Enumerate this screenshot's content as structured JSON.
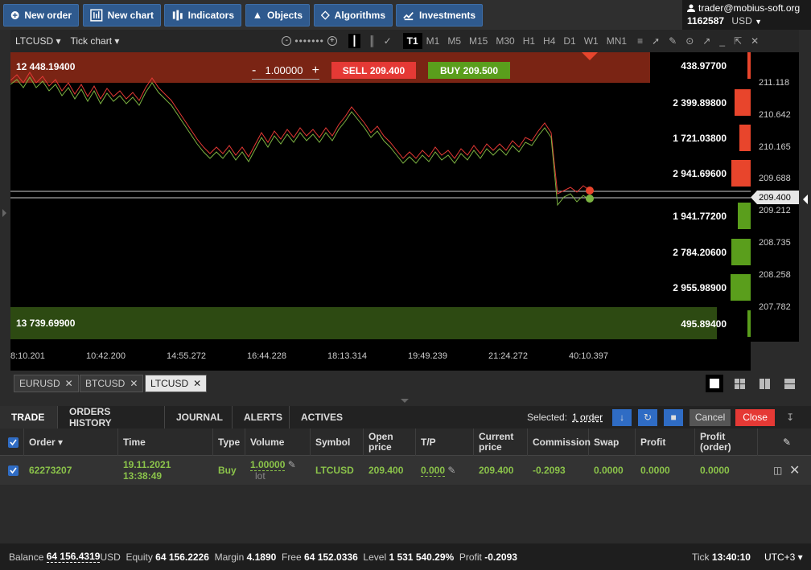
{
  "toolbar": {
    "new_order": "New order",
    "new_chart": "New chart",
    "indicators": "Indicators",
    "objects": "Objects",
    "algorithms": "Algorithms",
    "investments": "Investments"
  },
  "account": {
    "email": "trader@mobius-soft.org",
    "number": "1162587",
    "currency": "USD"
  },
  "chart_toolbar": {
    "symbol": "LTCUSD",
    "chart_type": "Tick chart",
    "timeframes": [
      "T1",
      "M1",
      "M5",
      "M15",
      "M30",
      "H1",
      "H4",
      "D1",
      "W1",
      "MN1"
    ],
    "active_timeframe": "T1"
  },
  "chart": {
    "upper_band_value": "12 448.19400",
    "lower_band_value": "13 739.69900",
    "quantity": "1.00000",
    "sell_label": "SELL",
    "sell_price": "209.400",
    "buy_label": "BUY",
    "buy_price": "209.500",
    "levels": [
      {
        "value": "438.97700",
        "side": "sell"
      },
      {
        "value": "2 399.89800",
        "side": "sell"
      },
      {
        "value": "1 721.03800",
        "side": "sell"
      },
      {
        "value": "2 941.69600",
        "side": "sell"
      },
      {
        "value": "1 941.77200",
        "side": "buy"
      },
      {
        "value": "2 784.20600",
        "side": "buy"
      },
      {
        "value": "2 955.98900",
        "side": "buy"
      },
      {
        "value": "495.89400",
        "side": "buy"
      }
    ],
    "price_ticks": [
      "211.118",
      "210.642",
      "210.165",
      "209.688",
      "209.212",
      "208.735",
      "208.258",
      "207.782"
    ],
    "current_price": "209.400",
    "time_ticks": [
      "8:10.201",
      "10:42.200",
      "14:55.272",
      "16:44.228",
      "18:13.314",
      "19:49.239",
      "21:24.272",
      "40:10.397"
    ],
    "colors": {
      "ask_line": "#e53935",
      "bid_line": "#7cb342",
      "sell": "#e8452c",
      "buy": "#5a9e1c"
    }
  },
  "symbol_tabs": [
    "EURUSD",
    "BTCUSD",
    "LTCUSD"
  ],
  "active_symbol_tab": "LTCUSD",
  "panel_tabs": [
    "TRADE",
    "ORDERS HISTORY",
    "JOURNAL",
    "ALERTS",
    "ACTIVES"
  ],
  "panel_actions": {
    "selected_label": "Selected:",
    "selected_value": "1 order",
    "cancel": "Cancel",
    "close": "Close"
  },
  "table": {
    "headers": [
      "Order",
      "Time",
      "Type",
      "Volume",
      "Symbol",
      "Open price",
      "T/P",
      "Current price",
      "Commission",
      "Swap",
      "Profit",
      "Profit (order)"
    ],
    "rows": [
      {
        "order": "62273207",
        "date": "19.11.2021",
        "time": "13:38:49",
        "type": "Buy",
        "volume": "1.00000",
        "volume_unit": "lot",
        "symbol": "LTCUSD",
        "open_price": "209.400",
        "tp": "0.000",
        "current_price": "209.400",
        "commission": "-0.2093",
        "swap": "0.0000",
        "profit": "0.0000",
        "profit_order": "0.0000"
      }
    ]
  },
  "status": {
    "balance_label": "Balance",
    "balance": "64 156.4319",
    "balance_cur": "USD",
    "equity_label": "Equity",
    "equity": "64 156.2226",
    "margin_label": "Margin",
    "margin": "4.1890",
    "free_label": "Free",
    "free": "64 152.0336",
    "level_label": "Level",
    "level": "1 531 540.29%",
    "profit_label": "Profit",
    "profit": "-0.2093",
    "tick_label": "Tick",
    "tick": "13:40:10",
    "tz": "UTC+3"
  }
}
